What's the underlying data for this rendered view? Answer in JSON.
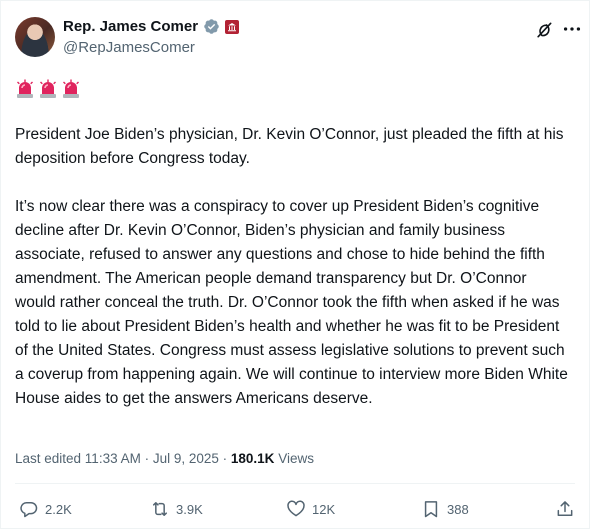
{
  "author": {
    "name": "Rep. James Comer",
    "handle": "@RepJamesComer"
  },
  "post": {
    "emojis": [
      "siren-emoji",
      "siren-emoji",
      "siren-emoji"
    ],
    "text": "President Joe Biden’s physician, Dr. Kevin O’Connor, just pleaded the fifth at his deposition before Congress today.\n\nIt’s now clear there was a conspiracy to cover up President Biden’s cognitive decline after Dr. Kevin O’Connor, Biden’s physician and family business associate, refused to answer any questions and chose to hide behind the fifth amendment. The American people demand transparency but Dr. O’Connor would rather conceal the truth. Dr. O’Connor took the fifth when asked if he was told to lie about President Biden’s health and whether he was fit to be President of the United States. Congress must assess legislative solutions to prevent such a coverup from happening again. We will continue to interview more Biden White House aides to get the answers Americans deserve.",
    "edited_label": "Last edited 11:33 AM · Jul 9, 2025 · ",
    "views_count": "180.1K",
    "views_label": " Views"
  },
  "actions": {
    "replies": "2.2K",
    "reposts": "3.9K",
    "likes": "12K",
    "bookmarks": "388"
  },
  "colors": {
    "text": "#0f1419",
    "secondary": "#536471",
    "verified": "#829aab",
    "affiliation": "#b22234",
    "siren": "#e0245e"
  }
}
